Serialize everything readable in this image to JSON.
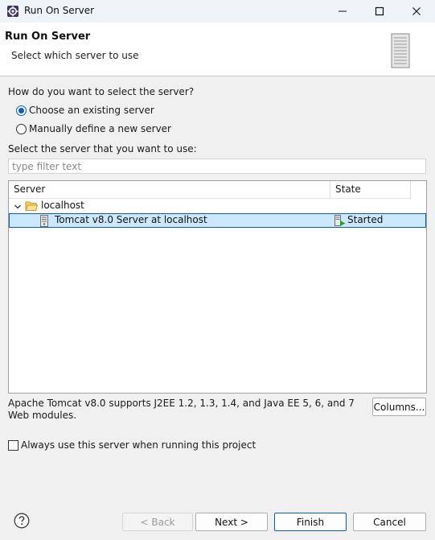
{
  "window": {
    "title": "Run On Server",
    "icons": {
      "app": "gear-icon",
      "minimize": "minimize-icon",
      "maximize": "maximize-icon",
      "close": "close-icon"
    }
  },
  "header": {
    "title": "Run On Server",
    "description": "Select which server to use",
    "image": "server-tower-icon"
  },
  "selection": {
    "question": "How do you want to select the server?",
    "options": [
      {
        "label": "Choose an existing server",
        "checked": true
      },
      {
        "label": "Manually define a new server",
        "checked": false
      }
    ]
  },
  "server_list": {
    "prompt": "Select the server that you want to use:",
    "filter_placeholder": "type filter text",
    "filter_value": "",
    "columns": [
      "Server",
      "State"
    ],
    "host": {
      "label": "localhost",
      "expanded": true,
      "icon": "folder-open-icon"
    },
    "servers": [
      {
        "name": "Tomcat v8.0 Server at localhost",
        "state": "Started",
        "selected": true,
        "icon": "server-icon",
        "state_icon": "started-icon"
      }
    ]
  },
  "description": "Apache Tomcat v8.0 supports J2EE 1.2, 1.3, 1.4, and Java EE 5, 6, and 7 Web modules.",
  "columns_button": "Columns...",
  "always_use": {
    "label": "Always use this server when running this project",
    "checked": false
  },
  "footer": {
    "help_icon": "help-icon",
    "back": "< Back",
    "next": "Next >",
    "finish": "Finish",
    "cancel": "Cancel"
  },
  "colors": {
    "accent": "#0a5cb5",
    "selection_bg": "#cce8ff",
    "titlebar_bg": "#eff4f9",
    "dialog_bg": "#f0f0f0"
  }
}
